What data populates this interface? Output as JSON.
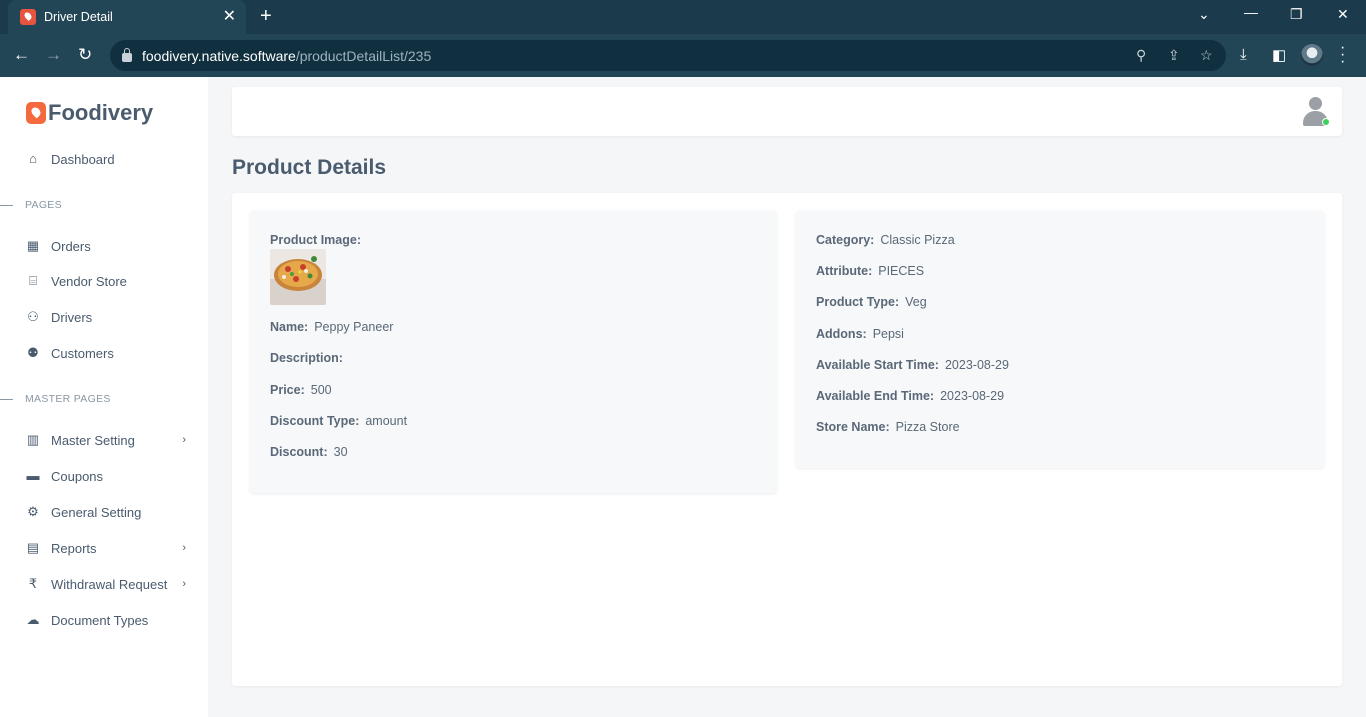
{
  "browser": {
    "tab_title": "Driver Detail",
    "url_host": "foodivery.native.software",
    "url_path": "/productDetailList/235"
  },
  "sidebar": {
    "brand": "Foodivery",
    "items": [
      {
        "label": "Dashboard",
        "icon": "home-icon"
      },
      {
        "section": "PAGES"
      },
      {
        "label": "Orders",
        "icon": "grid-icon"
      },
      {
        "label": "Vendor Store",
        "icon": "store-icon"
      },
      {
        "label": "Drivers",
        "icon": "user-icon"
      },
      {
        "label": "Customers",
        "icon": "users-icon"
      },
      {
        "section": "MASTER PAGES"
      },
      {
        "label": "Master Setting",
        "icon": "book-icon",
        "has_submenu": true
      },
      {
        "label": "Coupons",
        "icon": "ticket-icon"
      },
      {
        "label": "General Setting",
        "icon": "gear-icon"
      },
      {
        "label": "Reports",
        "icon": "document-icon",
        "has_submenu": true
      },
      {
        "label": "Withdrawal Request",
        "icon": "rupee-icon",
        "has_submenu": true
      },
      {
        "label": "Document Types",
        "icon": "cloud-upload-icon"
      }
    ]
  },
  "page": {
    "title": "Product Details"
  },
  "product": {
    "left": {
      "image_label": "Product Image:",
      "fields": [
        {
          "label": "Name:",
          "value": "Peppy Paneer"
        },
        {
          "label": "Description:",
          "value": ""
        },
        {
          "label": "Price:",
          "value": "500"
        },
        {
          "label": "Discount Type:",
          "value": "amount"
        },
        {
          "label": "Discount:",
          "value": "30"
        }
      ]
    },
    "right": {
      "fields": [
        {
          "label": "Category:",
          "value": "Classic Pizza"
        },
        {
          "label": "Attribute:",
          "value": "PIECES"
        },
        {
          "label": "Product Type:",
          "value": "Veg"
        },
        {
          "label": "Addons:",
          "value": "Pepsi"
        },
        {
          "label": "Available Start Time:",
          "value": "2023-08-29"
        },
        {
          "label": "Available End Time:",
          "value": "2023-08-29"
        },
        {
          "label": "Store Name:",
          "value": "Pizza Store"
        }
      ]
    }
  }
}
